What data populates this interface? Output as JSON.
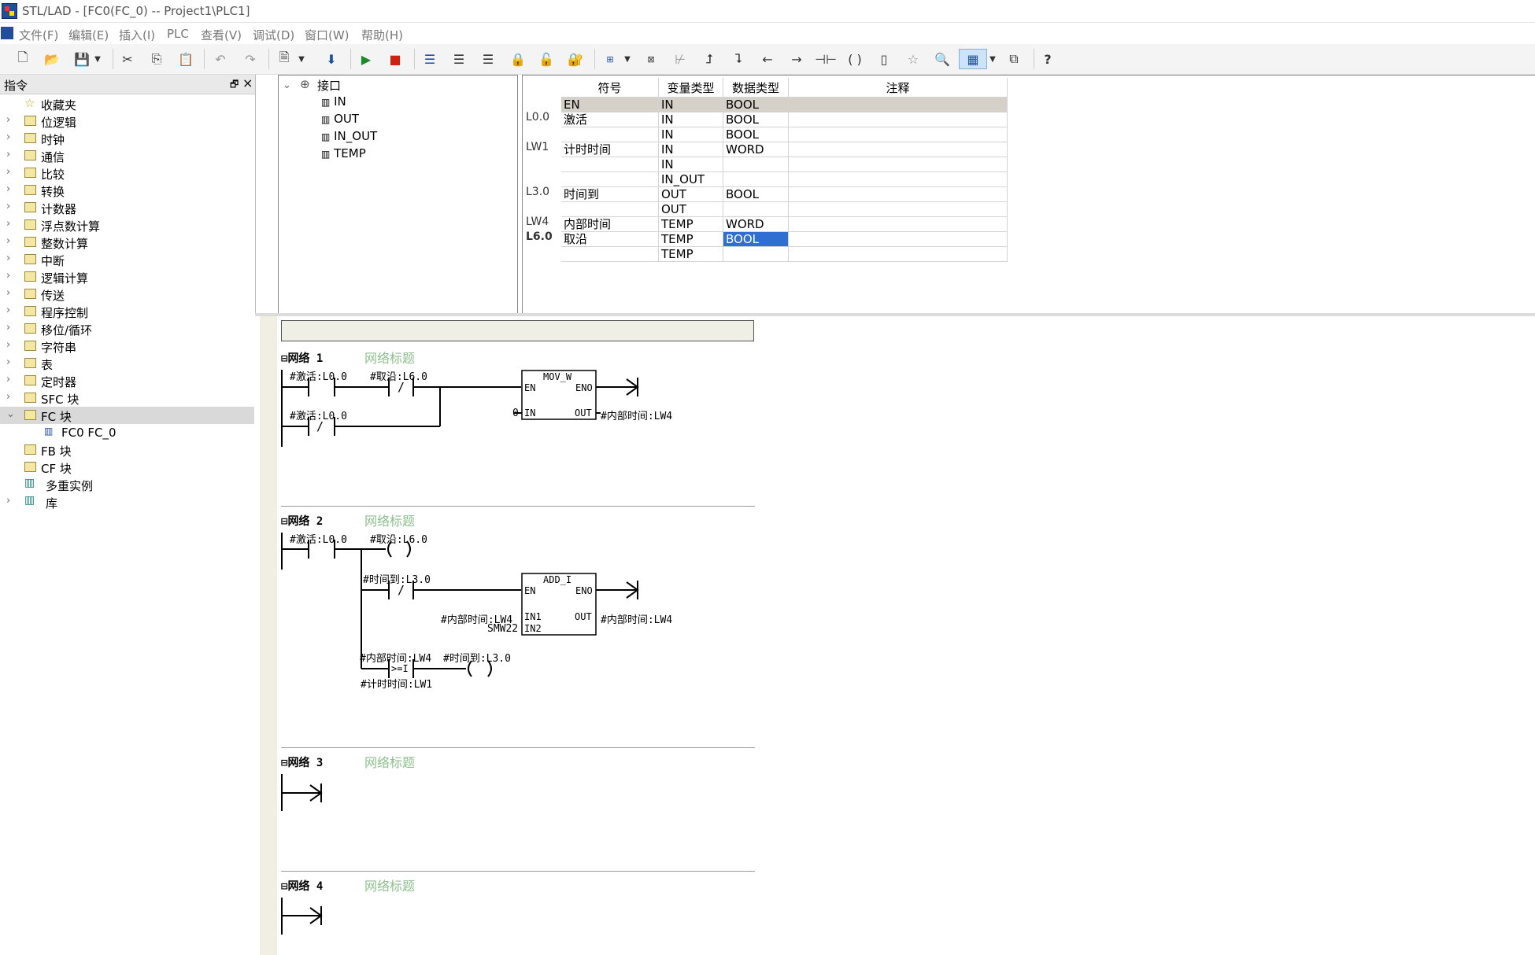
{
  "window": {
    "title": "STL/LAD - [FC0(FC_0) -- Project1\\PLC1]"
  },
  "menu": [
    "文件(F)",
    "编辑(E)",
    "插入(I)",
    "PLC",
    "查看(V)",
    "调试(D)",
    "窗口(W)",
    "帮助(H)"
  ],
  "left_panel": {
    "title": "指令",
    "items": [
      {
        "label": "收藏夹",
        "icon": "star-icon",
        "chevron": false
      },
      {
        "label": "位逻辑",
        "icon": "folder-icon",
        "chevron": true
      },
      {
        "label": "时钟",
        "icon": "folder-icon",
        "chevron": true
      },
      {
        "label": "通信",
        "icon": "folder-icon",
        "chevron": true
      },
      {
        "label": "比较",
        "icon": "folder-icon",
        "chevron": true
      },
      {
        "label": "转换",
        "icon": "folder-icon",
        "chevron": true
      },
      {
        "label": "计数器",
        "icon": "folder-icon",
        "chevron": true
      },
      {
        "label": "浮点数计算",
        "icon": "folder-icon",
        "chevron": true
      },
      {
        "label": "整数计算",
        "icon": "folder-icon",
        "chevron": true
      },
      {
        "label": "中断",
        "icon": "folder-icon",
        "chevron": true
      },
      {
        "label": "逻辑计算",
        "icon": "folder-icon",
        "chevron": true
      },
      {
        "label": "传送",
        "icon": "folder-icon",
        "chevron": true
      },
      {
        "label": "程序控制",
        "icon": "folder-icon",
        "chevron": true
      },
      {
        "label": "移位/循环",
        "icon": "folder-icon",
        "chevron": true
      },
      {
        "label": "字符串",
        "icon": "folder-icon",
        "chevron": true
      },
      {
        "label": "表",
        "icon": "folder-icon",
        "chevron": true
      },
      {
        "label": "定时器",
        "icon": "folder-icon",
        "chevron": true
      },
      {
        "label": "SFC 块",
        "icon": "folder-icon",
        "chevron": true
      },
      {
        "label": "FC 块",
        "icon": "folder-icon",
        "chevron": true,
        "expanded": true,
        "selected": true
      },
      {
        "label": "FC0  FC_0",
        "icon": "block-icon",
        "chevron": false,
        "child": true
      },
      {
        "label": "FB 块",
        "icon": "folder-icon",
        "chevron": false
      },
      {
        "label": "CF 块",
        "icon": "folder-icon",
        "chevron": false
      },
      {
        "label": "多重实例",
        "icon": "library-icon",
        "chevron": false
      },
      {
        "label": "库",
        "icon": "library-icon",
        "chevron": true
      }
    ]
  },
  "interface": {
    "root": "接口",
    "items": [
      "IN",
      "OUT",
      "IN_OUT",
      "TEMP"
    ]
  },
  "var_table": {
    "headers": [
      "符号",
      "变量类型",
      "数据类型",
      "注释"
    ],
    "rows": [
      {
        "addr": "",
        "symbol": "EN",
        "vtype": "IN",
        "dtype": "BOOL",
        "comment": "",
        "highlight": true
      },
      {
        "addr": "L0.0",
        "symbol": "激活",
        "vtype": "IN",
        "dtype": "BOOL",
        "comment": ""
      },
      {
        "addr": "",
        "symbol": "",
        "vtype": "IN",
        "dtype": "BOOL",
        "comment": ""
      },
      {
        "addr": "LW1",
        "symbol": "计时时间",
        "vtype": "IN",
        "dtype": "WORD",
        "comment": ""
      },
      {
        "addr": "",
        "symbol": "",
        "vtype": "IN",
        "dtype": "",
        "comment": ""
      },
      {
        "addr": "",
        "symbol": "",
        "vtype": "IN_OUT",
        "dtype": "",
        "comment": ""
      },
      {
        "addr": "L3.0",
        "symbol": "时间到",
        "vtype": "OUT",
        "dtype": "BOOL",
        "comment": ""
      },
      {
        "addr": "",
        "symbol": "",
        "vtype": "OUT",
        "dtype": "",
        "comment": ""
      },
      {
        "addr": "LW4",
        "symbol": "内部时间",
        "vtype": "TEMP",
        "dtype": "WORD",
        "comment": ""
      },
      {
        "addr": "L6.0",
        "symbol": "取沿",
        "vtype": "TEMP",
        "dtype": "BOOL",
        "comment": "",
        "dtype_selected": true
      },
      {
        "addr": "",
        "symbol": "",
        "vtype": "TEMP",
        "dtype": "",
        "comment": ""
      }
    ]
  },
  "networks": [
    {
      "label": "网络 1",
      "title": "网络标题"
    },
    {
      "label": "网络 2",
      "title": "网络标题"
    },
    {
      "label": "网络 3",
      "title": "网络标题"
    },
    {
      "label": "网络 4",
      "title": "网络标题"
    }
  ],
  "ladder": {
    "n1": {
      "c1": "#激活:L0.0",
      "c2": "#取沿:L6.0",
      "c3": "#激活:L0.0",
      "box": "MOV_W",
      "en": "EN",
      "eno": "ENO",
      "in": "IN",
      "out": "OUT",
      "in_val": "0",
      "out_val": "#内部时间:LW4"
    },
    "n2": {
      "c1": "#激活:L0.0",
      "coil1": "#取沿:L6.0",
      "c2": "#时间到:L3.0",
      "box": "ADD_I",
      "en": "EN",
      "eno": "ENO",
      "in1": "IN1",
      "in2": "IN2",
      "out": "OUT",
      "in1_val": "#内部时间:LW4",
      "in2_val": "SMW22",
      "out_val": "#内部时间:LW4",
      "cmp_top": "#内部时间:LW4",
      "cmp_op": ">=I",
      "cmp_bot": "#计时时间:LW1",
      "coil2": "#时间到:L3.0"
    },
    "contact_not": "/"
  }
}
